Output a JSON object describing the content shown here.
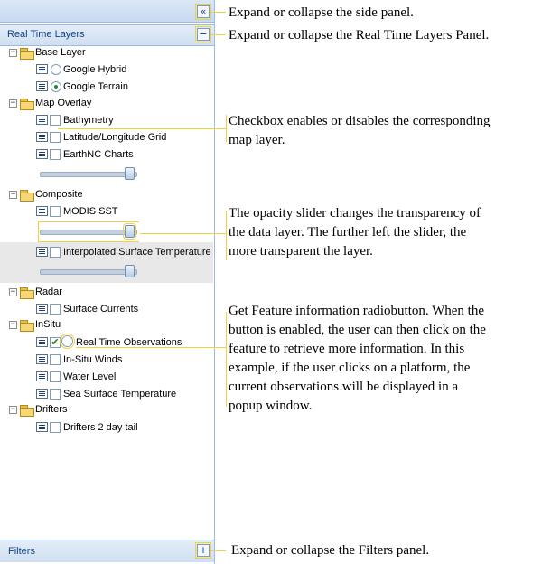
{
  "panel": {
    "collapse_icon": "double-chevron-left-icon",
    "collapse_glyph": "«",
    "layers_header": {
      "title": "Real Time Layers",
      "toggle_glyph": "−"
    },
    "groups": [
      {
        "name": "Base Layer",
        "expander": "−",
        "items": [
          {
            "label": "Google Hybrid",
            "control": "radio",
            "checked": false
          },
          {
            "label": "Google Terrain",
            "control": "radio",
            "checked": true
          }
        ]
      },
      {
        "name": "Map Overlay",
        "expander": "−",
        "items": [
          {
            "label": "Bathymetry",
            "control": "checkbox",
            "checked": false
          },
          {
            "label": "Latitude/Longitude Grid",
            "control": "checkbox",
            "checked": false
          },
          {
            "label": "EarthNC Charts",
            "control": "checkbox",
            "checked": false
          }
        ]
      },
      {
        "name": "Composite",
        "expander": "−",
        "items": [
          {
            "label": "MODIS SST",
            "control": "checkbox",
            "checked": false
          },
          {
            "label": "Interpolated Surface Temperature",
            "control": "checkbox",
            "checked": false
          }
        ]
      },
      {
        "name": "Radar",
        "expander": "−",
        "items": [
          {
            "label": "Surface Currents",
            "control": "checkbox",
            "checked": false
          }
        ]
      },
      {
        "name": "InSitu",
        "expander": "−",
        "items": [
          {
            "label": "Real Time Observations",
            "control": "checkbox",
            "checked": true,
            "check_glyph": "✔"
          },
          {
            "label": "In-Situ Winds",
            "control": "checkbox",
            "checked": false
          },
          {
            "label": "Water Level",
            "control": "checkbox",
            "checked": false
          },
          {
            "label": "Sea Surface Temperature",
            "control": "checkbox",
            "checked": false
          }
        ]
      },
      {
        "name": "Drifters",
        "expander": "−",
        "items": [
          {
            "label": "Drifters 2 day tail",
            "control": "checkbox",
            "checked": false
          }
        ]
      }
    ],
    "opacity_sliders": {
      "value": 1.0
    },
    "filters_footer": {
      "title": "Filters",
      "toggle_glyph": "+"
    }
  },
  "annotations": {
    "side_panel": "Expand or collapse the side panel.",
    "layers_panel": "Expand or collapse the Real Time Layers Panel.",
    "checkbox": [
      "Checkbox enables or disables the corresponding",
      "map layer."
    ],
    "opacity": [
      "The opacity slider changes the transparency of",
      "the data layer.  The further left the slider, the",
      "more transparent the layer."
    ],
    "feature_info": [
      "Get Feature information radiobutton. When the",
      "button is enabled, the user can then click on the",
      "feature to retrieve more information. In this",
      "example, if the user clicks on a platform, the",
      "current observations will be displayed in a",
      "popup window."
    ],
    "filters_panel": "Expand or collapse the Filters panel."
  },
  "colors": {
    "highlight": "#f2d23a",
    "panel_border": "#99bbe8",
    "header_text": "#15428b"
  }
}
